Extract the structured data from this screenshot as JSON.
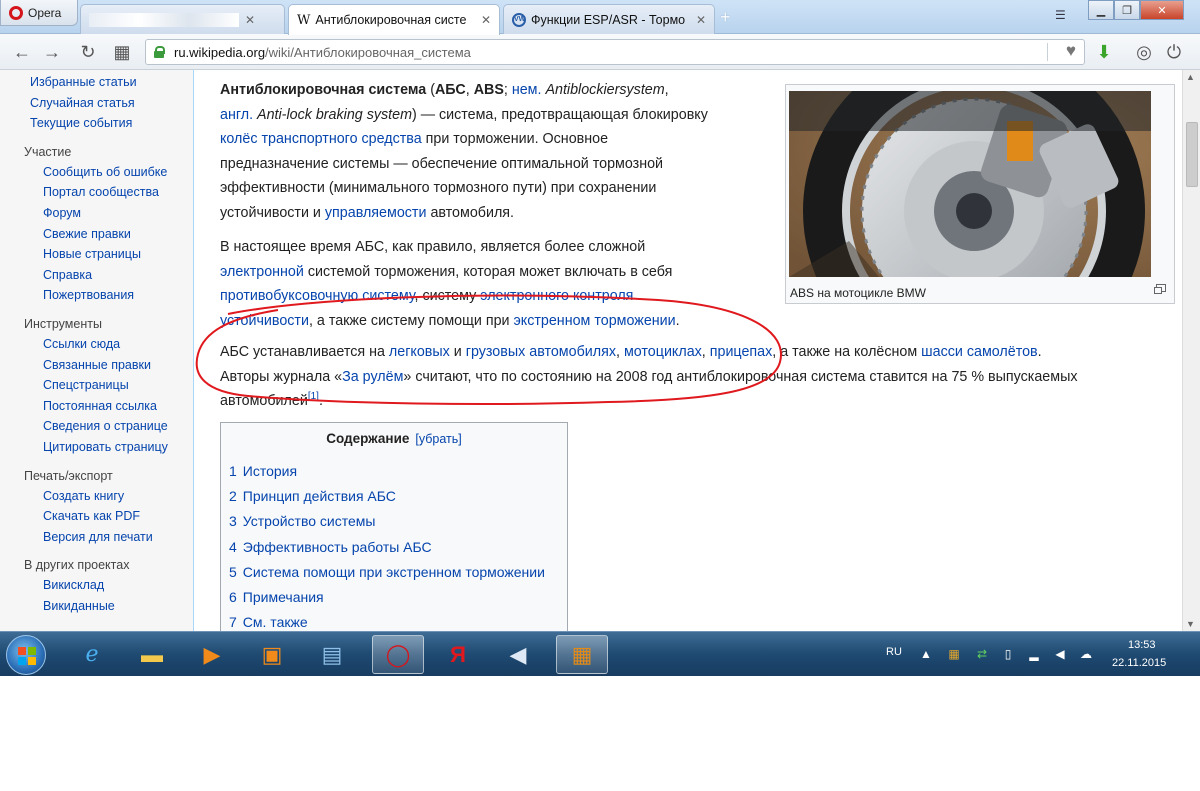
{
  "browser": {
    "opera_label": "Opera",
    "tabs": [
      {
        "label": "Антиблокировочная систе",
        "icon": "wikipedia-icon",
        "active": true
      },
      {
        "label": "Функции ESP/ASR - Тормо",
        "icon": "vw-icon",
        "active": false
      }
    ],
    "new_tab": "+",
    "url_host": "ru.wikipedia.org",
    "url_path": "/wiki/Антиблокировочная_система"
  },
  "sidebar": {
    "top_links": [
      "Избранные статьи",
      "Случайная статья",
      "Текущие события"
    ],
    "sections": [
      {
        "heading": "Участие",
        "links": [
          "Сообщить об ошибке",
          "Портал сообщества",
          "Форум",
          "Свежие правки",
          "Новые страницы",
          "Справка",
          "Пожертвования"
        ]
      },
      {
        "heading": "Инструменты",
        "links": [
          "Ссылки сюда",
          "Связанные правки",
          "Спецстраницы",
          "Постоянная ссылка",
          "Сведения о странице",
          "Цитировать страницу"
        ]
      },
      {
        "heading": "Печать/экспорт",
        "links": [
          "Создать книгу",
          "Скачать как PDF",
          "Версия для печати"
        ]
      },
      {
        "heading": "В других проектах",
        "links": [
          "Викисклад",
          "Викиданные"
        ]
      }
    ]
  },
  "article": {
    "p1": {
      "l1_a": "Антиблокировочная система",
      "l1_b": " (",
      "l1_c": "АБС",
      "l1_d": ", ",
      "l1_e": "ABS",
      "l1_f": "; ",
      "l1_g": "нем.",
      "l1_h": " ",
      "l1_i": "Antiblockiersystem",
      "l1_j": ",",
      "l2_a": "англ.",
      "l2_b": " ",
      "l2_c": "Anti-lock braking system",
      "l2_d": ") — система, предотвращающая блокировку",
      "l3_a": "колёс транспортного средства",
      "l3_b": " при торможении. Основное",
      "l4": "предназначение системы — обеспечение оптимальной тормозной",
      "l5": "эффективности (минимального тормозного пути) при сохранении",
      "l6_a": "устойчивости и ",
      "l6_b": "управляемости",
      "l6_c": " автомобиля."
    },
    "p2": {
      "l1": "В настоящее время АБС, как правило, является более сложной",
      "l2_a": "электронной",
      "l2_b": " системой торможения, которая может включать в себя",
      "l3_a": "противобуксовочную систему",
      "l3_b": ", систему ",
      "l3_c": "электронного контроля",
      "l4_a": "устойчивости",
      "l4_b": ", а также систему помощи при ",
      "l4_c": "экстренном торможении",
      "l4_d": "."
    },
    "p3": {
      "l1_a": "АБС устанавливается на ",
      "l1_b": "легковых",
      "l1_c": " и ",
      "l1_d": "грузовых автомобилях",
      "l1_e": ", ",
      "l1_f": "мотоциклах",
      "l1_g": ", ",
      "l1_h": "прицепах",
      "l1_i": ", а также на колёсном ",
      "l1_j": "шасси самолётов",
      "l1_k": ".",
      "l2_a": "Авторы журнала «",
      "l2_b": "За рулём",
      "l2_c": "» считают, что по состоянию на 2008 год антиблокировочная система ставится на 75 % выпускаемых",
      "l3_a": "автомобилей",
      "l3_sup": "[1]",
      "l3_b": "."
    },
    "thumb_caption": "ABS на мотоцикле BMW"
  },
  "toc": {
    "title": "Содержание",
    "hide": "[убрать]",
    "items": [
      {
        "num": "1",
        "label": "История"
      },
      {
        "num": "2",
        "label": "Принцип действия АБС"
      },
      {
        "num": "3",
        "label": "Устройство системы"
      },
      {
        "num": "4",
        "label": "Эффективность работы АБС"
      },
      {
        "num": "5",
        "label": "Система помощи при экстренном торможении"
      },
      {
        "num": "6",
        "label": "Примечания"
      },
      {
        "num": "7",
        "label": "См. также"
      }
    ]
  },
  "taskbar": {
    "lang": "RU",
    "time": "13:53",
    "date": "22.11.2015"
  },
  "colors": {
    "link": "#0645ad",
    "highlight_ring": "#e0191e",
    "taskbar": "#1f4a72"
  }
}
